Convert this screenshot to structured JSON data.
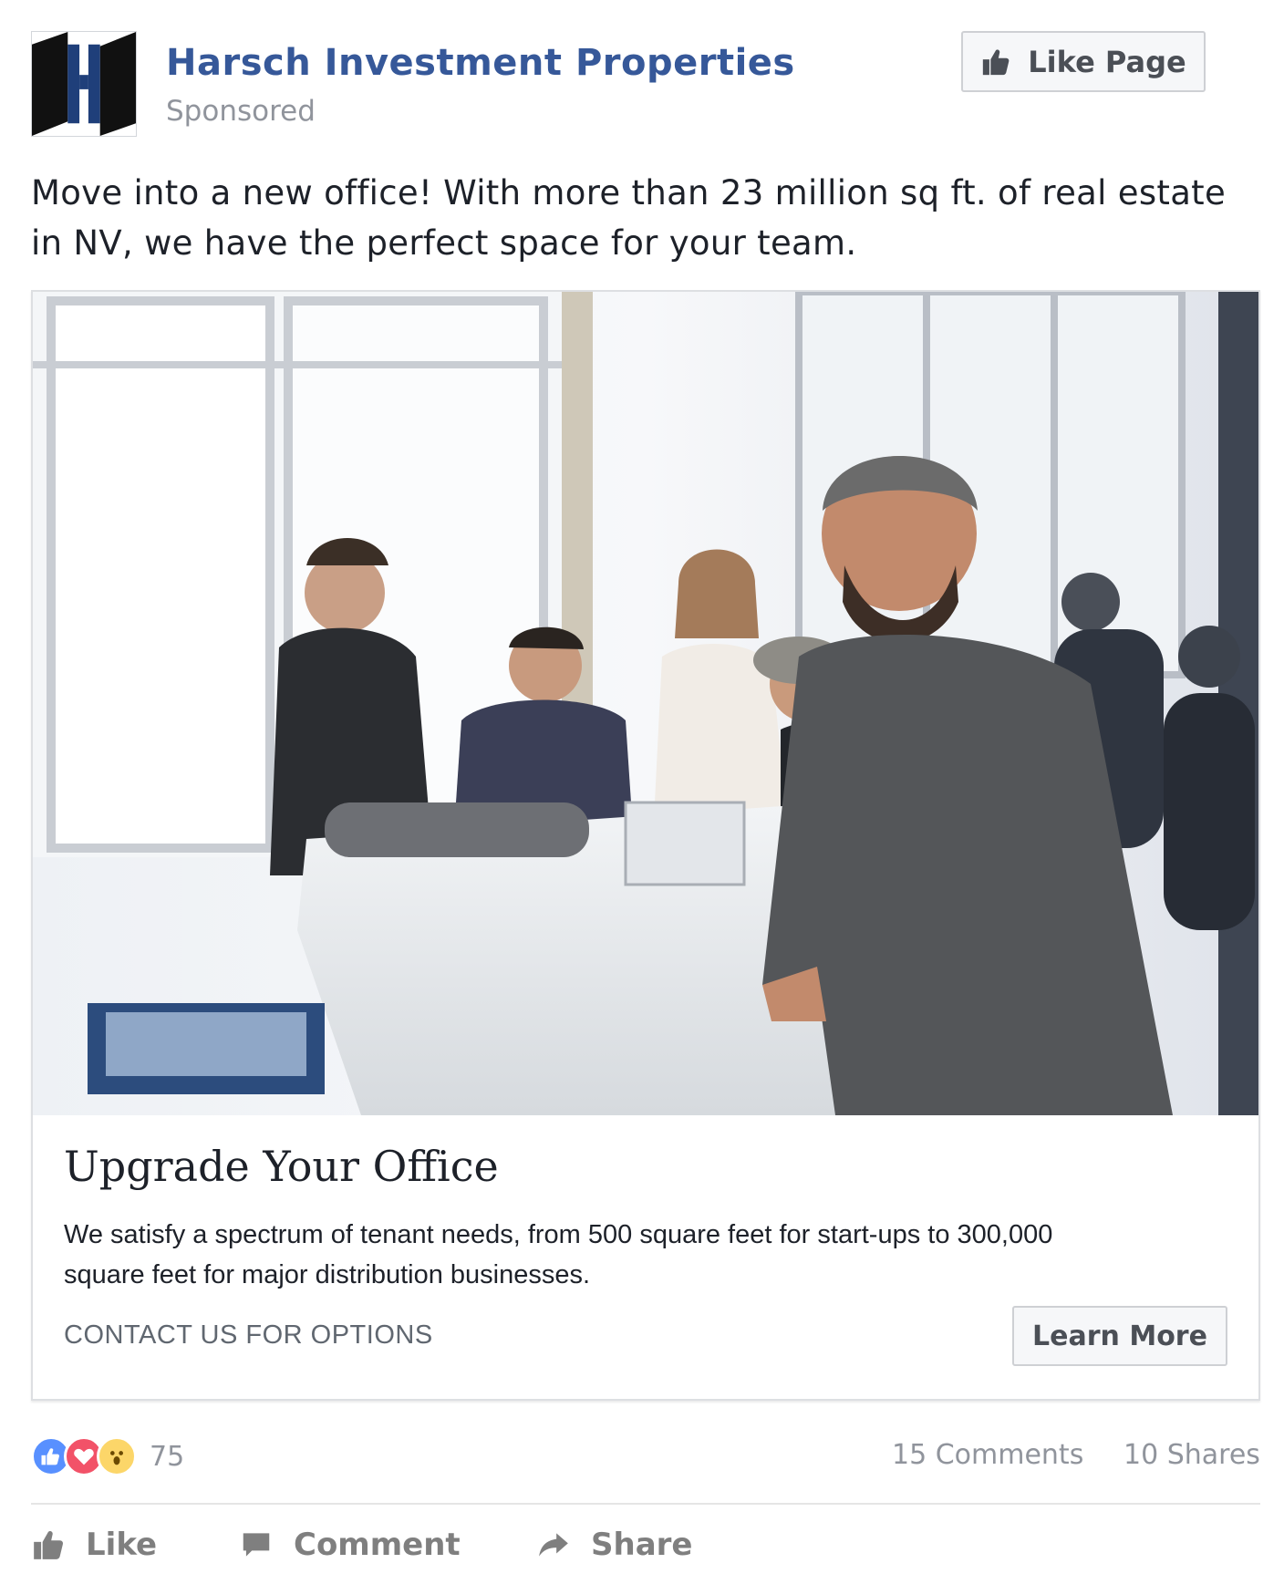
{
  "header": {
    "page_name": "Harsch Investment Properties",
    "sponsored_label": "Sponsored",
    "like_page_label": "Like Page",
    "logo_letter": "H"
  },
  "post": {
    "text": "Move into a new office! With more than 23 million sq ft. of real estate in NV, we have the perfect space for your team."
  },
  "card": {
    "title": "Upgrade Your Office",
    "description": "We satisfy a spectrum of tenant needs, from 500 square feet for start-ups to 300,000 square feet for major distribution businesses.",
    "caption": "CONTACT US FOR OPTIONS",
    "cta_label": "Learn More"
  },
  "stats": {
    "reaction_icons": [
      "like-icon",
      "love-icon",
      "wow-icon"
    ],
    "reaction_count": "75",
    "comments": "15 Comments",
    "shares": "10 Shares"
  },
  "actions": {
    "like": "Like",
    "comment": "Comment",
    "share": "Share"
  },
  "colors": {
    "brand_blue": "#365899",
    "logo_navy": "#1f3f7a",
    "muted_text": "#90949c"
  }
}
